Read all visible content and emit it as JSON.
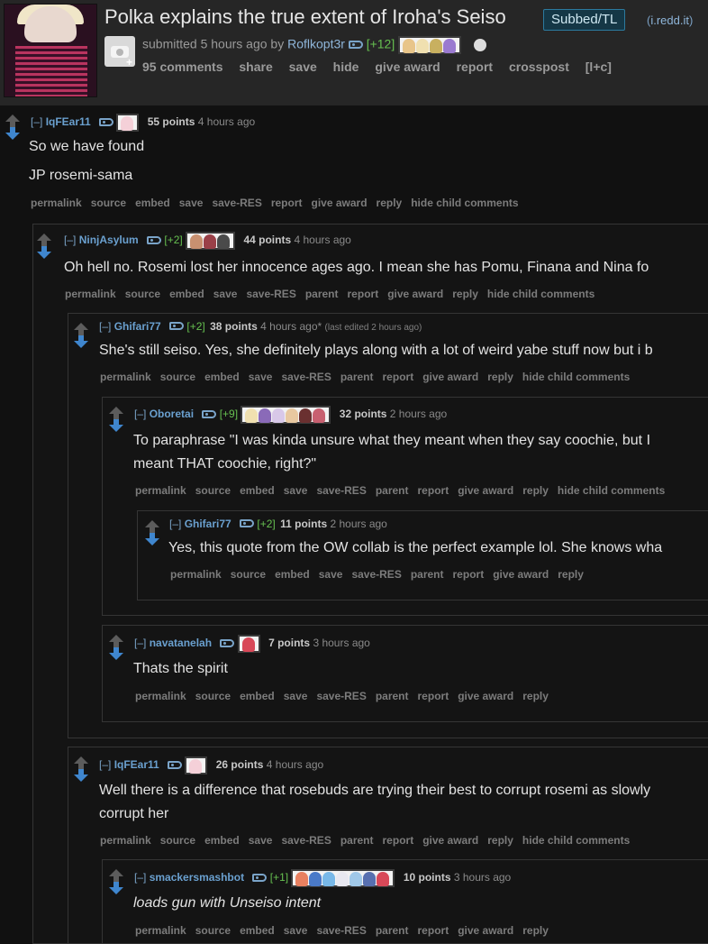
{
  "post": {
    "title": "Polka explains the true extent of Iroha's Seiso",
    "flair": "Subbed/TL",
    "domain": "i.redd.it",
    "submitted": "submitted 5 hours ago by",
    "author": "Roflkopt3r",
    "author_karma": "[+12]",
    "buttons": [
      "95 comments",
      "share",
      "save",
      "hide",
      "give award",
      "report",
      "crosspost",
      "[l+c]"
    ]
  },
  "actions_full": [
    "permalink",
    "source",
    "embed",
    "save",
    "save-RES",
    "parent",
    "report",
    "give award",
    "reply",
    "hide child comments"
  ],
  "comments": [
    {
      "collapse": "[–]",
      "author": "IqFEar11",
      "karma": "",
      "score": "55 points",
      "time": "4 hours ago",
      "edited": "",
      "body": [
        "So we have found",
        "JP rosemi-sama"
      ],
      "actions": [
        "permalink",
        "source",
        "embed",
        "save",
        "save-RES",
        "report",
        "give award",
        "reply",
        "hide child comments"
      ]
    },
    {
      "collapse": "[–]",
      "author": "NinjAsylum",
      "karma": "[+2]",
      "score": "44 points",
      "time": "4 hours ago",
      "edited": "",
      "body": [
        "Oh hell no. Rosemi lost her innocence ages ago. I mean she has Pomu, Finana and Nina fo"
      ],
      "actions": [
        "permalink",
        "source",
        "embed",
        "save",
        "save-RES",
        "parent",
        "report",
        "give award",
        "reply",
        "hide child comments"
      ]
    },
    {
      "collapse": "[–]",
      "author": "Ghifari77",
      "karma": "[+2]",
      "score": "38 points",
      "time": "4 hours ago*",
      "edited": "(last edited 2 hours ago)",
      "body": [
        "She's still seiso. Yes, she definitely plays along with a lot of weird yabe stuff now but i b"
      ],
      "actions": [
        "permalink",
        "source",
        "embed",
        "save",
        "save-RES",
        "parent",
        "report",
        "give award",
        "reply",
        "hide child comments"
      ]
    },
    {
      "collapse": "[–]",
      "author": "Oboretai",
      "karma": "[+9]",
      "score": "32 points",
      "time": "2 hours ago",
      "edited": "",
      "body": [
        "To paraphrase \"I was kinda unsure what they meant when they say coochie, but I",
        "meant THAT coochie, right?\""
      ],
      "actions": [
        "permalink",
        "source",
        "embed",
        "save",
        "save-RES",
        "parent",
        "report",
        "give award",
        "reply",
        "hide child comments"
      ]
    },
    {
      "collapse": "[–]",
      "author": "Ghifari77",
      "karma": "[+2]",
      "score": "11 points",
      "time": "2 hours ago",
      "edited": "",
      "body": [
        "Yes, this quote from the OW collab is the perfect example lol. She knows wha"
      ],
      "actions": [
        "permalink",
        "source",
        "embed",
        "save",
        "save-RES",
        "parent",
        "report",
        "give award",
        "reply"
      ]
    },
    {
      "collapse": "[–]",
      "author": "navatanelah",
      "karma": "",
      "score": "7 points",
      "time": "3 hours ago",
      "edited": "",
      "body": [
        "Thats the spirit"
      ],
      "actions": [
        "permalink",
        "source",
        "embed",
        "save",
        "save-RES",
        "parent",
        "report",
        "give award",
        "reply"
      ]
    },
    {
      "collapse": "[–]",
      "author": "IqFEar11",
      "karma": "",
      "score": "26 points",
      "time": "4 hours ago",
      "edited": "",
      "body": [
        "Well there is a difference that rosebuds are trying their best to corrupt rosemi as slowly",
        "corrupt her"
      ],
      "actions": [
        "permalink",
        "source",
        "embed",
        "save",
        "save-RES",
        "parent",
        "report",
        "give award",
        "reply",
        "hide child comments"
      ]
    },
    {
      "collapse": "[–]",
      "author": "smackersmashbot",
      "karma": "[+1]",
      "score": "10 points",
      "time": "3 hours ago",
      "edited": "",
      "body": [
        "loads gun with Unseiso intent"
      ],
      "actions": [
        "permalink",
        "source",
        "embed",
        "save",
        "save-RES",
        "parent",
        "report",
        "give award",
        "reply"
      ]
    }
  ]
}
